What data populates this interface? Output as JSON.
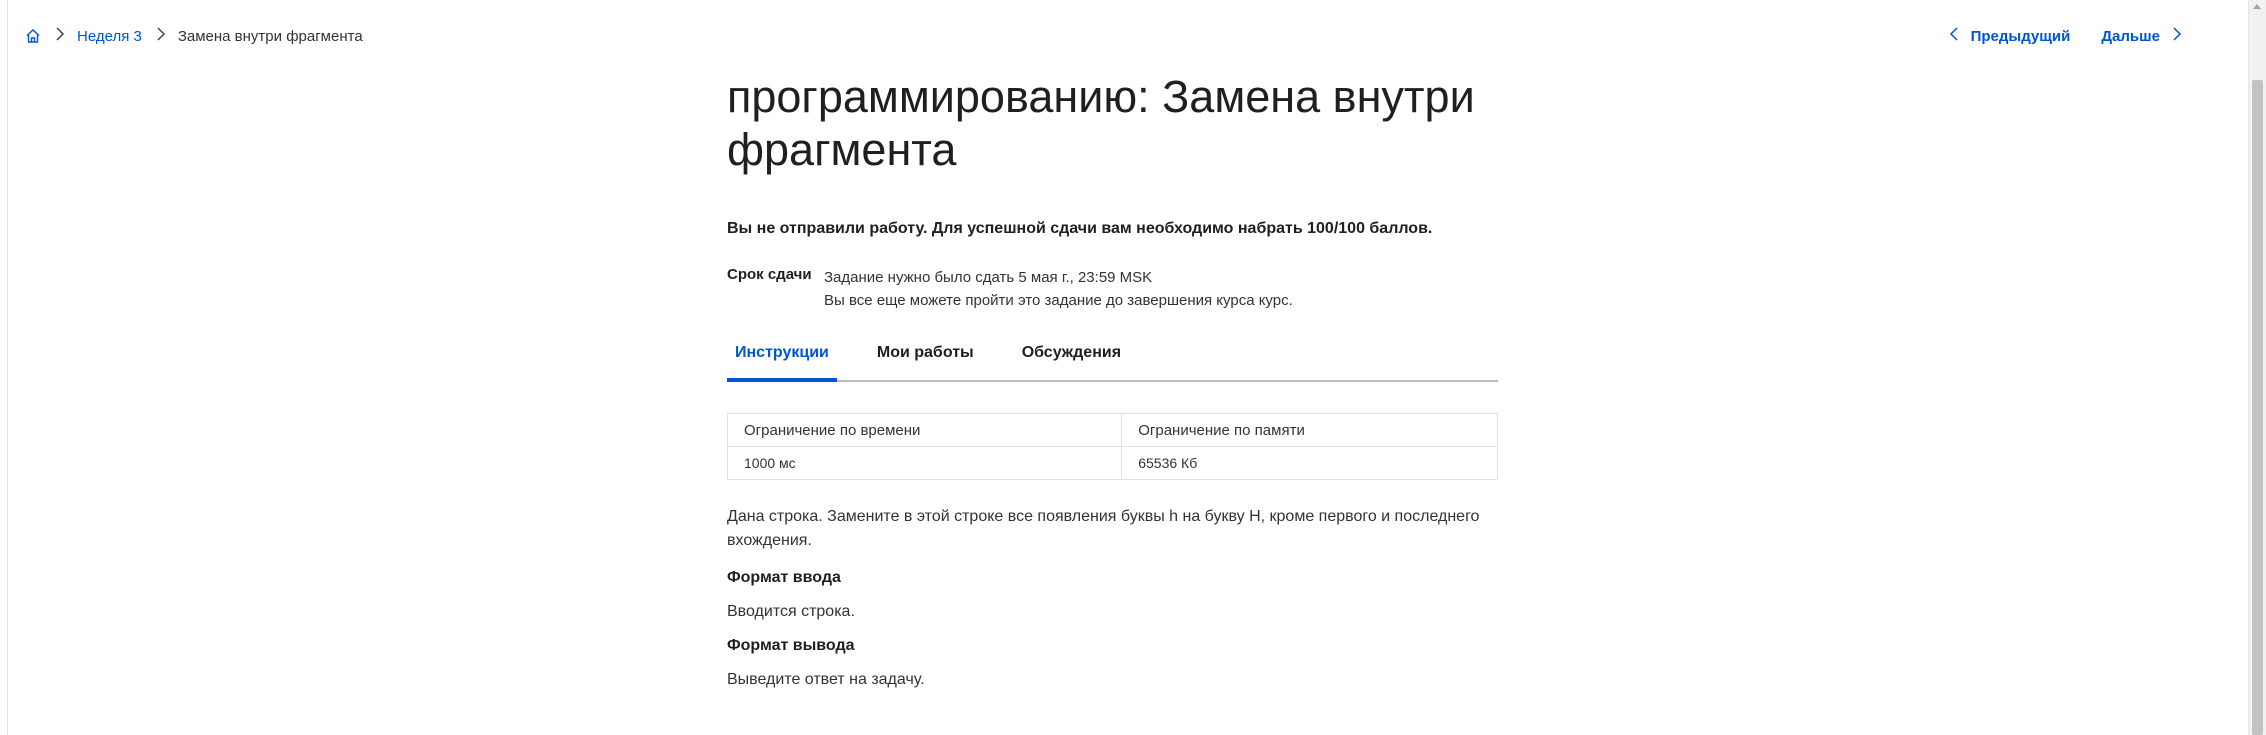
{
  "breadcrumb": {
    "week": "Неделя 3",
    "current": "Замена внутри фрагмента"
  },
  "pager": {
    "prev": "Предыдущий",
    "next": "Дальше"
  },
  "assignment": {
    "title": "программированию: Замена внутри фрагмента",
    "status": "Вы не отправили работу. Для успешной сдачи вам необходимо набрать 100/100 баллов.",
    "deadline_label": "Срок сдачи",
    "deadline_text": "Задание нужно было сдать 5 мая г., 23:59 MSK",
    "deadline_note": "Вы все еще можете пройти это задание до завершения курса курс."
  },
  "tabs": [
    {
      "label": "Инструкции",
      "active": true
    },
    {
      "label": "Мои работы",
      "active": false
    },
    {
      "label": "Обсуждения",
      "active": false
    }
  ],
  "limits": {
    "headers": [
      "Ограничение по времени",
      "Ограничение по памяти"
    ],
    "values": [
      "1000 мс",
      "65536 Кб"
    ]
  },
  "problem": {
    "description": "Дана строка. Замените в этой строке все появления буквы h на букву H, кроме первого и последнего вхождения.",
    "input_heading": "Формат ввода",
    "input_text": "Вводится строка.",
    "output_heading": "Формат вывода",
    "output_text": "Выведите ответ на задачу."
  },
  "colors": {
    "accent": "#0056d2",
    "text": "#1f1f1f"
  },
  "icons": {
    "home": "home-icon",
    "separator": "chevron-right-icon",
    "prev": "chevron-left-icon",
    "next": "chevron-right-icon"
  }
}
